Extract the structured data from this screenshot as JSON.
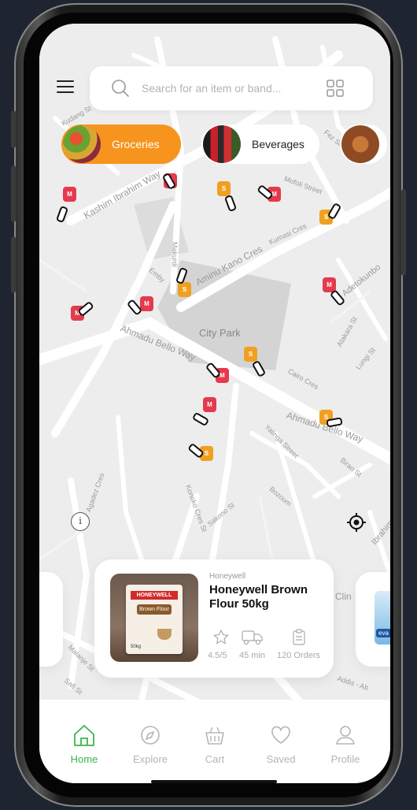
{
  "search": {
    "placeholder": "Search for an item or band..."
  },
  "categories": [
    {
      "label": "Groceries",
      "active": true
    },
    {
      "label": "Beverages",
      "active": false
    }
  ],
  "map_labels": {
    "kashim": "Kashim Ibrahim Way",
    "aminu_kano": "Aminu Kano Cres",
    "ahmadu_bello_top": "Ahmadu Bello Way",
    "ahmadu_bello_right": "Ahmadu Bello Way",
    "city_park": "City Park",
    "kumasi": "Kumasi Cres",
    "mofoli": "Mofoli Street",
    "adetokunbo": "Adetokunbo",
    "cairo": "Cairo Cres",
    "agadez": "Agadez Cres",
    "yalinga": "Yalinga Street",
    "bozoum": "Bozoum",
    "konoko": "Konoko Cres St",
    "sakono": "Sakono St",
    "makurdi": "Makurdi",
    "kudang": "Kudang St",
    "fez": "Fez St",
    "birao": "Birao St",
    "lungi": "Lungi St",
    "atakara": "Atakara St",
    "malanje": "Malanje St",
    "safi": "Safi St",
    "addis": "Addis - Ab",
    "ibrahim_right": "Ibrahim",
    "emby": "Emby"
  },
  "product": {
    "brand": "Honeywell",
    "name": "Honeywell Brown Flour 50kg",
    "rating": "4.5/5",
    "time": "45 min",
    "orders": "120 Orders",
    "package_brand": "HONEYWELL",
    "package_text": "Brown Flour",
    "package_weight": "50kg"
  },
  "side_card_text": {
    "left": "ders",
    "right": "Clin",
    "right_brand": "eva"
  },
  "tabs": [
    {
      "label": "Home",
      "active": true
    },
    {
      "label": "Explore",
      "active": false
    },
    {
      "label": "Cart",
      "active": false
    },
    {
      "label": "Saved",
      "active": false
    },
    {
      "label": "Profile",
      "active": false
    }
  ],
  "colors": {
    "accent_orange": "#f7941d",
    "active_green": "#3cb44b",
    "marker_red": "#e5394d",
    "marker_orange": "#f0a020",
    "map_bg": "#ededed"
  },
  "marker_letters": {
    "m": "M",
    "s": "S"
  }
}
